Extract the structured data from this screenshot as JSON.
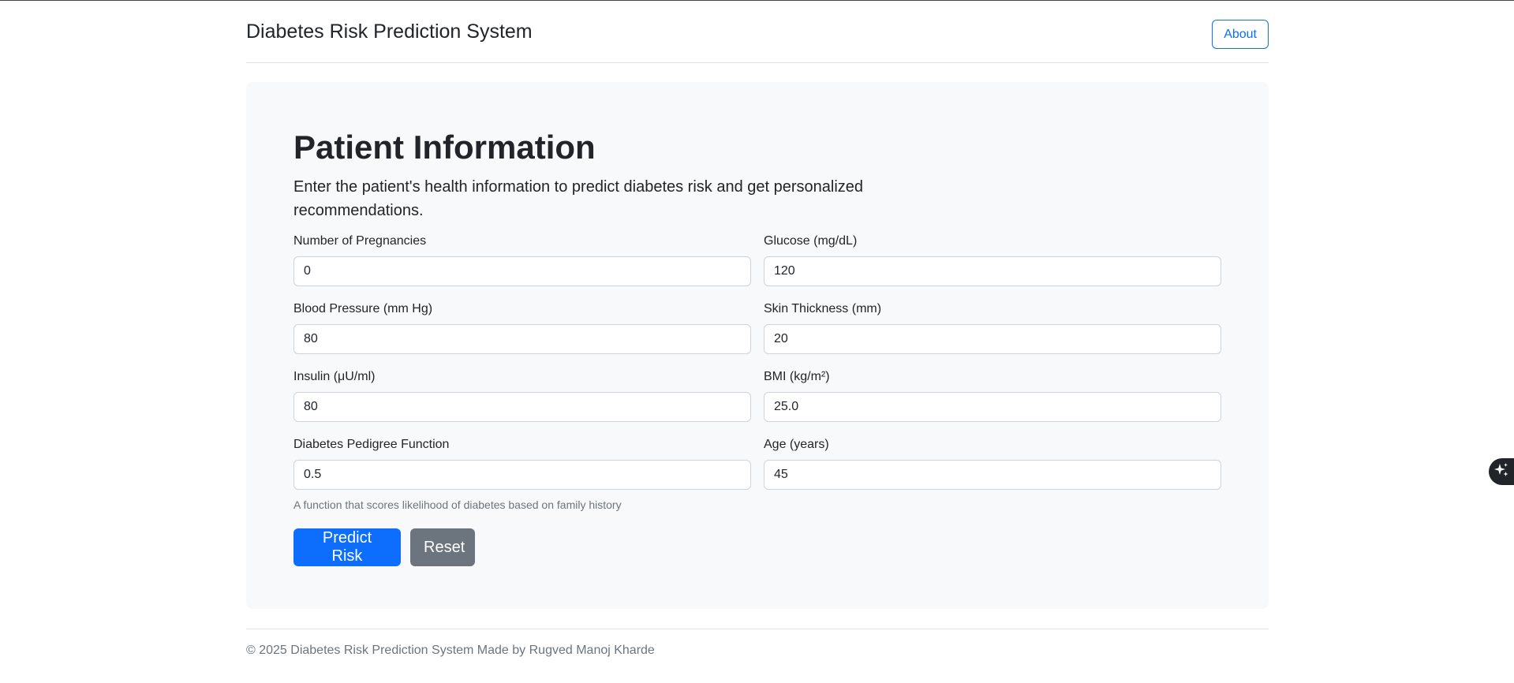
{
  "header": {
    "title": "Diabetes Risk Prediction System",
    "about_label": "About"
  },
  "main": {
    "heading": "Patient Information",
    "description": "Enter the patient's health information to predict diabetes risk and get personalized recommendations.",
    "fields": [
      {
        "label": "Number of Pregnancies",
        "value": "0"
      },
      {
        "label": "Glucose (mg/dL)",
        "value": "120"
      },
      {
        "label": "Blood Pressure (mm Hg)",
        "value": "80"
      },
      {
        "label": "Skin Thickness (mm)",
        "value": "20"
      },
      {
        "label": "Insulin (μU/ml)",
        "value": "80"
      },
      {
        "label": "BMI (kg/m²)",
        "value": "25.0"
      },
      {
        "label": "Diabetes Pedigree Function",
        "value": "0.5"
      },
      {
        "label": "Age (years)",
        "value": "45"
      }
    ],
    "pedigree_hint": "A function that scores likelihood of diabetes based on family history",
    "predict_label": "Predict Risk",
    "reset_label": "Reset"
  },
  "footer": {
    "text": "© 2025 Diabetes Risk Prediction System Made by Rugved Manoj Kharde"
  },
  "icons": {
    "assistant": "sparkle-icon"
  }
}
